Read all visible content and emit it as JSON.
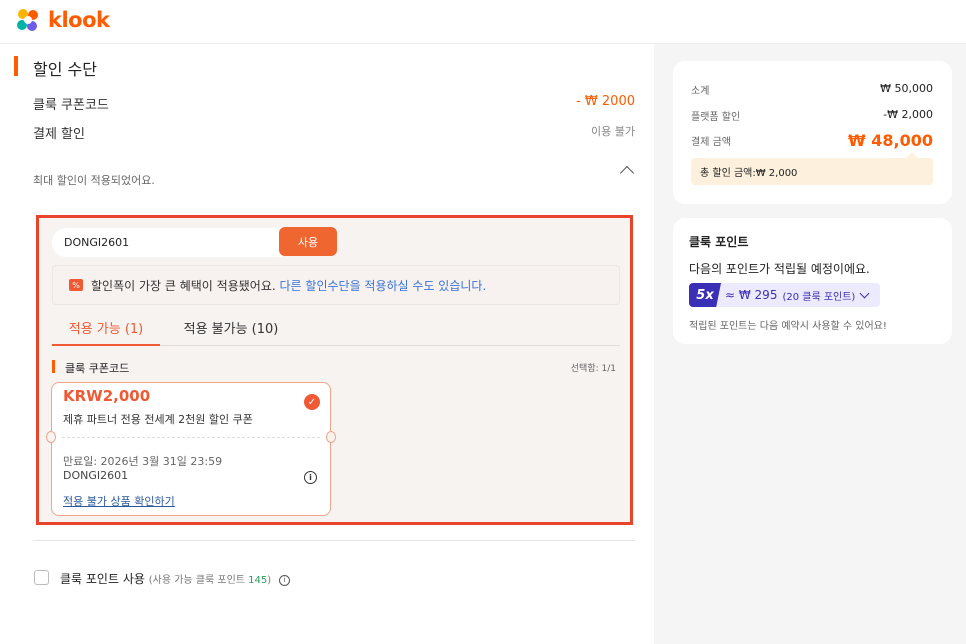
{
  "brand": {
    "name": "klook",
    "accent": "#ff5b00",
    "highlight": "#e8432b"
  },
  "discount": {
    "title": "할인 수단",
    "rows": [
      {
        "label": "클룩 쿠폰코드",
        "value": "- ₩ 2000"
      },
      {
        "label": "결제 할인",
        "value": "이용 불가"
      }
    ],
    "max_note": "최대 할인이 적용되었어요."
  },
  "coupon_panel": {
    "code_value": "DONGI2601",
    "apply_label": "사용",
    "notice_text": "할인폭이 가장 큰 혜택이 적용됐어요.",
    "notice_link": "다른 할인수단을 적용하실 수도 있습니다.",
    "tabs": [
      {
        "label": "적용 가능 (1)",
        "active": true
      },
      {
        "label": "적용 불가능 (10)",
        "active": false
      }
    ],
    "section_title": "클룩 쿠폰코드",
    "selected_count": "선택함: 1/1",
    "coupon": {
      "amount": "KRW2,000",
      "description": "제휴 파트너 전용 전세계 2천원 할인 쿠폰",
      "expiry": "만료일: 2026년 3월 31일 23:59",
      "code": "DONGI2601",
      "link": "적용 불가 상품 확인하기"
    }
  },
  "klook_points_use": {
    "label": "클룩 포인트 사용",
    "sub_prefix": "(사용 가능 클룩 포인트 ",
    "sub_value": "145",
    "sub_suffix": ")"
  },
  "summary": {
    "rows": [
      {
        "label": "소계",
        "value": "₩ 50,000"
      },
      {
        "label": "플랫폼 할인",
        "value": "-₩ 2,000"
      },
      {
        "label": "결제 금액",
        "value": "₩ 48,000"
      }
    ],
    "total_discount": "총 할인 금액:₩ 2,000"
  },
  "points_card": {
    "title": "클룩 포인트",
    "desc": "다음의 포인트가 적립될 예정이에요.",
    "multiplier": "5x",
    "amount": "≈ ₩ 295",
    "points": "(20 클룩 포인트)",
    "note": "적립된 포인트는 다음 예약시 사용할 수 있어요!"
  }
}
